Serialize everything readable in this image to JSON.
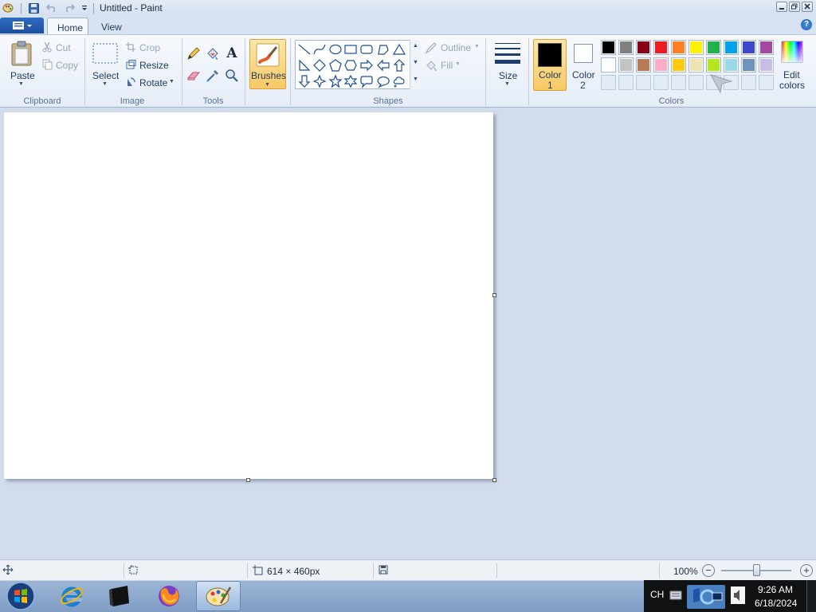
{
  "window": {
    "title": "Untitled - Paint"
  },
  "tabs": [
    {
      "label": "Home",
      "active": true
    },
    {
      "label": "View",
      "active": false
    }
  ],
  "help_label": "?",
  "ribbon": {
    "clipboard": {
      "label": "Clipboard",
      "paste": "Paste",
      "cut": "Cut",
      "copy": "Copy"
    },
    "image": {
      "label": "Image",
      "select": "Select",
      "crop": "Crop",
      "resize": "Resize",
      "rotate": "Rotate"
    },
    "tools": {
      "label": "Tools",
      "items": [
        "pencil-icon",
        "fill-bucket-icon",
        "text-icon",
        "eraser-icon",
        "color-picker-icon",
        "magnifier-icon"
      ],
      "text_glyph": "A"
    },
    "brushes": {
      "label": "Brushes"
    },
    "shapes": {
      "label": "Shapes",
      "outline": "Outline",
      "fill": "Fill",
      "items": [
        "line",
        "curve",
        "oval",
        "rectangle",
        "rounded-rectangle",
        "polygon",
        "triangle",
        "right-triangle",
        "diamond",
        "pentagon",
        "hexagon",
        "right-arrow",
        "left-arrow",
        "up-arrow",
        "down-arrow",
        "four-point-star",
        "five-point-star",
        "six-point-star",
        "rounded-rectangular-callout",
        "oval-callout",
        "cloud-callout"
      ]
    },
    "size": {
      "label": "Size"
    },
    "colors": {
      "label": "Colors",
      "color1_line1": "Color",
      "color1_line2": "1",
      "color2_line1": "Color",
      "color2_line2": "2",
      "color1_value": "#000000",
      "color2_value": "#ffffff",
      "edit_line1": "Edit",
      "edit_line2": "colors",
      "palette_row1": [
        "#000000",
        "#7f7f7f",
        "#880015",
        "#ed1c24",
        "#ff7f27",
        "#fff200",
        "#22b14c",
        "#00a2e8",
        "#3f48cc",
        "#a349a4"
      ],
      "palette_row2": [
        "#ffffff",
        "#c3c3c3",
        "#b97a57",
        "#ffaec9",
        "#ffc90e",
        "#efe4b0",
        "#b5e61d",
        "#99d9ea",
        "#7092be",
        "#c8bfe7"
      ]
    }
  },
  "status": {
    "dimensions": "614 × 460px",
    "zoom": "100%",
    "zoom_minus": "−",
    "zoom_plus": "+",
    "zoom_level": 0.5
  },
  "taskbar": {
    "items": [
      {
        "name": "internet-explorer-icon",
        "active": false
      },
      {
        "name": "terminal-icon",
        "active": false
      },
      {
        "name": "firefox-icon",
        "active": false
      },
      {
        "name": "paint-icon",
        "active": true
      }
    ],
    "language": "CH",
    "time": "9:26 AM",
    "date": "6/18/2024"
  }
}
